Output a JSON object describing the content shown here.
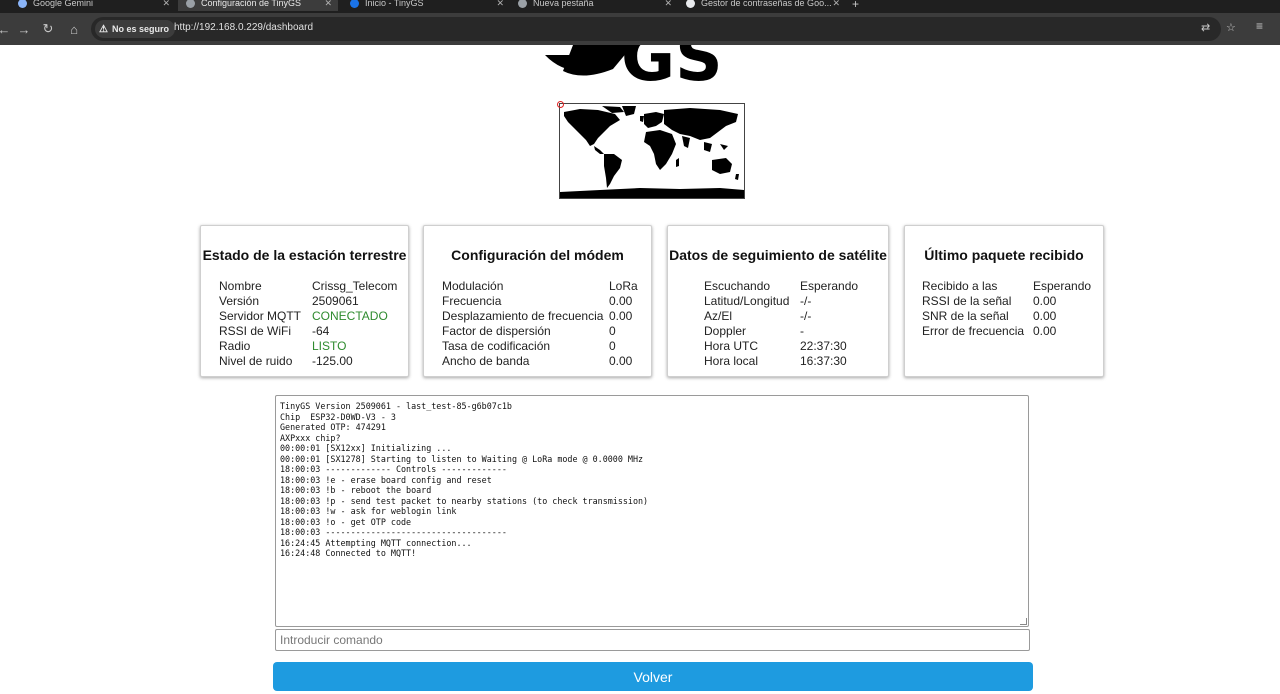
{
  "browser": {
    "tabs": [
      {
        "title": "Google Gemini",
        "active": false,
        "color": "#8ab4f8"
      },
      {
        "title": "Configuración de TinyGS",
        "active": true,
        "color": "#9aa0a6"
      },
      {
        "title": "Inicio - TinyGS",
        "active": false,
        "color": "#1a73e8"
      },
      {
        "title": "Nueva pestaña",
        "active": false,
        "color": "#9aa0a6"
      },
      {
        "title": "Gestor de contraseñas de Goo...",
        "active": false,
        "color": "#e8eaed"
      }
    ],
    "security_label": "No es seguro",
    "url": "http://192.168.0.229/dashboard"
  },
  "logo_text": "GS",
  "cards": {
    "station": {
      "title": "Estado de la estación terrestre",
      "rows": [
        {
          "key": "Nombre",
          "value": "Crissg_Telecom"
        },
        {
          "key": "Versión",
          "value": "2509061"
        },
        {
          "key": "Servidor MQTT",
          "value": "CONECTADO"
        },
        {
          "key": "RSSI de WiFi",
          "value": "-64"
        },
        {
          "key": "Radio",
          "value": "LISTO"
        },
        {
          "key": "Nivel de ruido",
          "value": "-125.00"
        }
      ]
    },
    "modem": {
      "title": "Configuración del módem",
      "rows": [
        {
          "key": "Modulación",
          "value": "LoRa"
        },
        {
          "key": "Frecuencia",
          "value": "0.00"
        },
        {
          "key": "Desplazamiento de frecuencia",
          "value": "0.00"
        },
        {
          "key": "Factor de dispersión",
          "value": "0"
        },
        {
          "key": "Tasa de codificación",
          "value": "0"
        },
        {
          "key": "Ancho de banda",
          "value": "0.00"
        }
      ]
    },
    "tracking": {
      "title": "Datos de seguimiento de satélite",
      "rows": [
        {
          "key": "Escuchando",
          "value": "Esperando"
        },
        {
          "key": "Latitud/Longitud",
          "value": "-/-"
        },
        {
          "key": "Az/El",
          "value": "-/-"
        },
        {
          "key": "Doppler",
          "value": "-"
        },
        {
          "key": "Hora UTC",
          "value": "22:37:30"
        },
        {
          "key": "Hora local",
          "value": "16:37:30"
        }
      ]
    },
    "packet": {
      "title": "Último paquete recibido",
      "rows": [
        {
          "key": "Recibido a las",
          "value": "Esperando"
        },
        {
          "key": "RSSI de la señal",
          "value": "0.00"
        },
        {
          "key": "SNR de la señal",
          "value": "0.00"
        },
        {
          "key": "Error de frecuencia",
          "value": "0.00"
        }
      ]
    }
  },
  "status_colors": {
    "ok": "#2e8b2e",
    "button": "#1e9be0"
  },
  "console_lines": [
    "TinyGS Version 2509061 - last_test-85-g6b07c1b",
    "Chip  ESP32-D0WD-V3 - 3",
    "Generated OTP: 474291",
    "AXPxxx chip?",
    "00:00:01 [SX12xx] Initializing ...",
    "00:00:01 [SX1278] Starting to listen to Waiting @ LoRa mode @ 0.0000 MHz",
    "18:00:03 ------------- Controls -------------",
    "18:00:03 !e - erase board config and reset",
    "18:00:03 !b - reboot the board",
    "18:00:03 !p - send test packet to nearby stations (to check transmission)",
    "18:00:03 !w - ask for weblogin link",
    "18:00:03 !o - get OTP code",
    "18:00:03 ------------------------------------",
    "16:24:45 Attempting MQTT connection...",
    "16:24:48 Connected to MQTT!"
  ],
  "command_input": {
    "placeholder": "Introducir comando",
    "value": ""
  },
  "back_button": "Volver"
}
